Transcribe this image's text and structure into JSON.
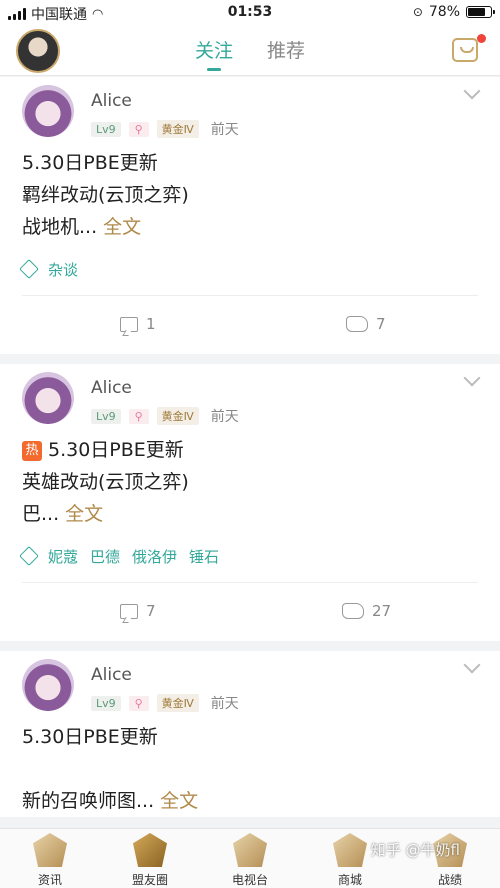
{
  "status": {
    "carrier": "中国联通",
    "time": "01:53",
    "battery": "78%",
    "battery_level": 0.78
  },
  "header": {
    "tabs": [
      {
        "label": "关注",
        "active": true
      },
      {
        "label": "推荐",
        "active": false
      }
    ]
  },
  "posts": [
    {
      "author": "Alice",
      "level": "Lv9",
      "rank": "黄金Ⅳ",
      "time": "前天",
      "hot": false,
      "lines": [
        "5.30日PBE更新",
        "羁绊改动(云顶之弈)"
      ],
      "last_line": "战地机...",
      "more": "全文",
      "tags": [
        "杂谈"
      ],
      "comments": "1",
      "likes": "7"
    },
    {
      "author": "Alice",
      "level": "Lv9",
      "rank": "黄金Ⅳ",
      "time": "前天",
      "hot": true,
      "hot_label": "热",
      "lines": [
        "5.30日PBE更新",
        "英雄改动(云顶之弈)"
      ],
      "last_line": "巴...",
      "more": "全文",
      "tags": [
        "妮蔻",
        "巴德",
        "俄洛伊",
        "锤石"
      ],
      "comments": "7",
      "likes": "27"
    },
    {
      "author": "Alice",
      "level": "Lv9",
      "rank": "黄金Ⅳ",
      "time": "前天",
      "hot": false,
      "lines": [
        "5.30日PBE更新",
        ""
      ],
      "last_line": "新的召唤师图...",
      "more": "全文"
    }
  ],
  "nav": [
    {
      "label": "资讯",
      "icon": "news-icon"
    },
    {
      "label": "盟友圈",
      "icon": "friends-circle-icon",
      "active": true
    },
    {
      "label": "电视台",
      "icon": "tv-icon"
    },
    {
      "label": "商城",
      "icon": "store-icon"
    },
    {
      "label": "战绩",
      "icon": "record-icon"
    }
  ],
  "watermark": "知乎 @牛奶fl"
}
